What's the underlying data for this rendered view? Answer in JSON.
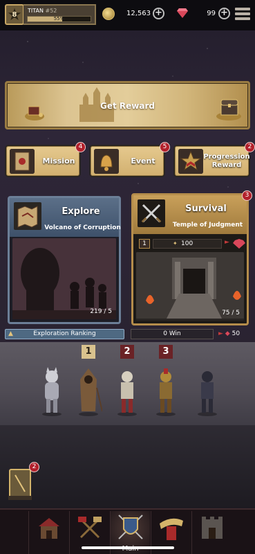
{
  "player": {
    "level": "8",
    "name": "TITAN",
    "generation": "#52",
    "xp_percent": 55,
    "xp_label": "55%"
  },
  "currency": {
    "gold": "12,563",
    "gems": "99"
  },
  "reward_banner": {
    "label": "Get Reward"
  },
  "quick_buttons": [
    {
      "label": "Mission",
      "badge": "4"
    },
    {
      "label": "Event",
      "badge": "5"
    },
    {
      "label": "Progression Reward",
      "badge": "2"
    }
  ],
  "explore": {
    "title": "Explore",
    "subtitle": "Volcano of Corruption",
    "count": "219 / 5"
  },
  "survival": {
    "title": "Survival",
    "subtitle": "Temple of Judgment",
    "badge": "3",
    "tier": "1",
    "power": "100",
    "count": "75 / 5"
  },
  "ranking": {
    "label": "Exploration Ranking",
    "wins": "0 Win",
    "gems": "50"
  },
  "slots": [
    "1",
    "2",
    "3"
  ],
  "book_badge": "2",
  "nav": {
    "items": [
      "home-nav",
      "forge-nav",
      "main-nav",
      "summon-nav",
      "guild-nav"
    ],
    "active_label": "Main"
  },
  "colors": {
    "accent_gold": "#c9a865",
    "badge_red": "#b2202b",
    "explore_blue": "#5b6f88"
  }
}
